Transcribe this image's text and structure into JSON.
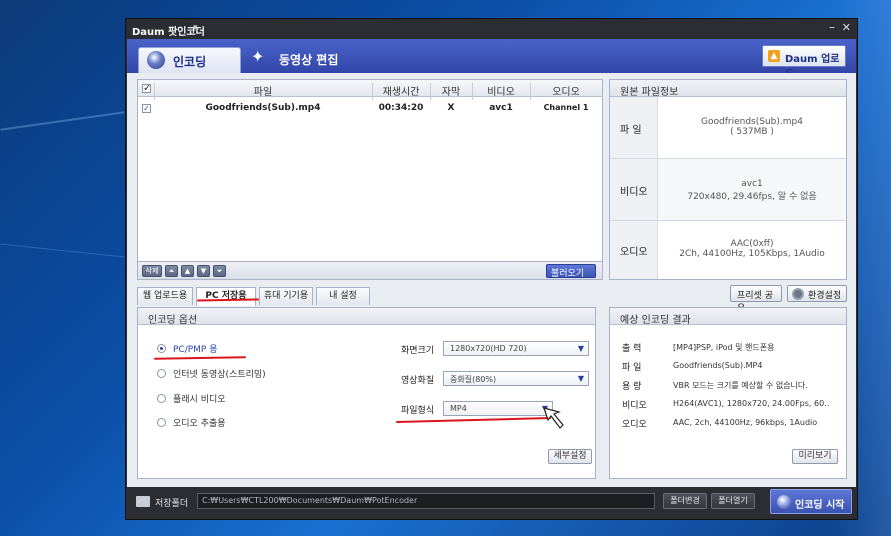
{
  "window": {
    "title": "Daum 팟인코더",
    "title_arrow": "▾",
    "minimize": "–",
    "close": "✕"
  },
  "top_tabs": {
    "encode": "인코딩",
    "edit": "동영상 편집",
    "daum_upload": "Daum 업로드"
  },
  "file_list": {
    "headers": {
      "file": "파일",
      "duration": "재생시간",
      "subtitle": "자막",
      "video": "비디오",
      "audio": "오디오"
    },
    "rows": [
      {
        "file": "Goodfriends(Sub).mp4",
        "duration": "00:34:20",
        "subtitle": "X",
        "video": "avc1",
        "audio": "Channel 1",
        "checked": true
      }
    ],
    "delete_label": "삭제",
    "load_label": "불러오기"
  },
  "source_info": {
    "title": "원본 파일정보",
    "file_key": "파 일",
    "file_name": "Goodfriends(Sub).mp4",
    "file_size": "( 537MB )",
    "video_key": "비디오",
    "video_codec": "avc1",
    "video_detail": "720x480, 29.46fps, 알 수 없음",
    "audio_key": "오디오",
    "audio_codec": "AAC(0xff)",
    "audio_detail": "2Ch, 44100Hz, 105Kbps, 1Audio"
  },
  "bottom_tabs": [
    {
      "label": "웹 업로드용"
    },
    {
      "label": "PC 저장용"
    },
    {
      "label": "휴대 기기용"
    },
    {
      "label": "내 설정"
    }
  ],
  "preset_share": "프리셋 공유",
  "settings": "환경설정",
  "options": {
    "title": "인코딩 옵션",
    "radios": [
      "PC/PMP 용",
      "인터넷 동영상(스트리밍)",
      "플래시 비디오",
      "오디오 추출용"
    ],
    "screen_size_label": "화면크기",
    "screen_size_value": "1280x720(HD 720)",
    "quality_label": "영상화질",
    "quality_value": "중화질(80%)",
    "format_label": "파일형식",
    "format_value": "MP4",
    "detail_button": "세부설정"
  },
  "result": {
    "title": "예상 인코딩 결과",
    "rows": [
      {
        "k": "출 력",
        "v": "[MP4]PSP, iPod 및 핸드폰용"
      },
      {
        "k": "파 일",
        "v": "Goodfriends(Sub).MP4"
      },
      {
        "k": "용 량",
        "v": "VBR 모드는 크기를 예상할 수 없습니다."
      },
      {
        "k": "비디오",
        "v": "H264(AVC1), 1280x720, 24.00Fps, 60.."
      },
      {
        "k": "오디오",
        "v": "AAC, 2ch, 44100Hz, 96kbps, 1Audio"
      }
    ],
    "preview_button": "미리보기"
  },
  "footer": {
    "folder_label": "저장폴더",
    "path": "C:₩Users₩CTL200₩Documents₩Daum₩PotEncoder",
    "change_folder": "폴더변경",
    "open_folder": "폴더열기",
    "start": "인코딩 시작"
  }
}
